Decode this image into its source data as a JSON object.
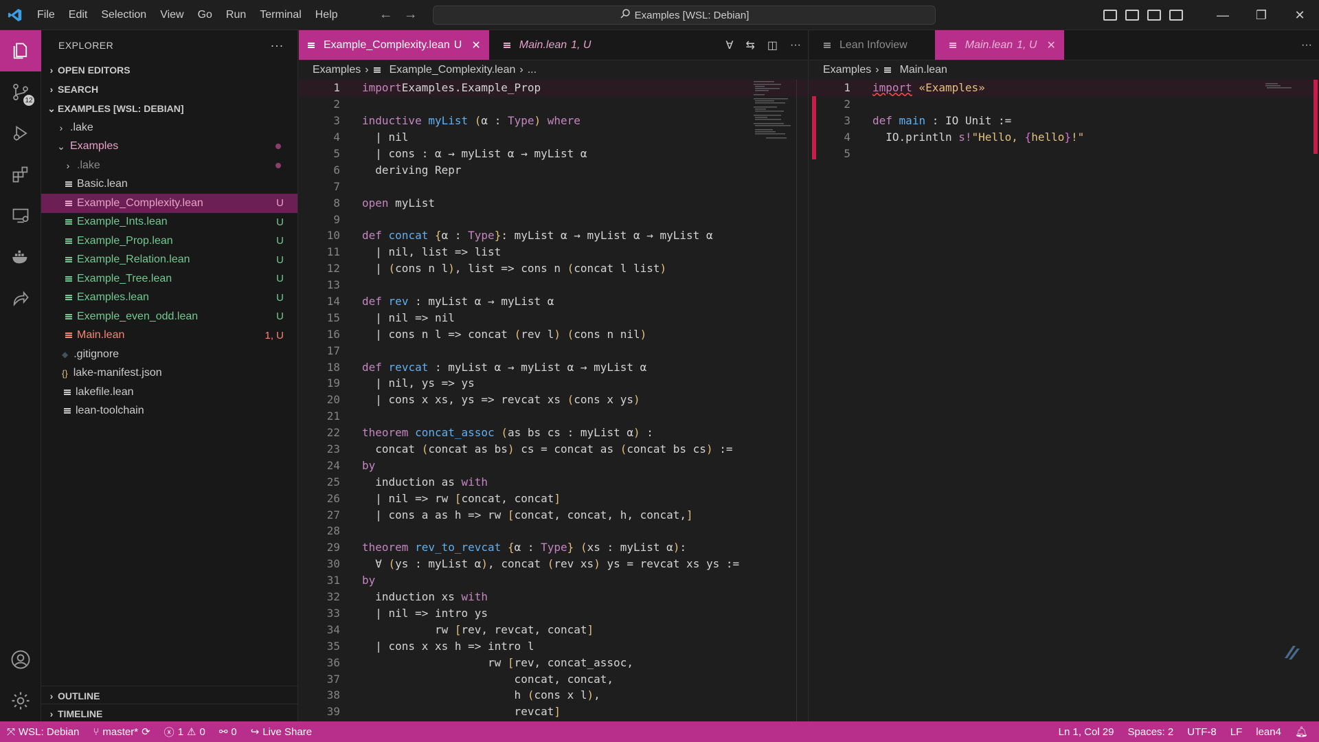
{
  "titlebar": {
    "menu": [
      "File",
      "Edit",
      "Selection",
      "View",
      "Go",
      "Run",
      "Terminal",
      "Help"
    ],
    "search": "Examples [WSL: Debian]"
  },
  "activity": {
    "scm_badge": "12"
  },
  "sidebar": {
    "title": "EXPLORER",
    "open_editors": "OPEN EDITORS",
    "search": "SEARCH",
    "workspace": "EXAMPLES [WSL: DEBIAN]",
    "tree": [
      {
        "name": ".lake",
        "indent": 1,
        "type": "folder",
        "open": false,
        "color": "#cccccc",
        "status": ""
      },
      {
        "name": "Examples",
        "indent": 1,
        "type": "folder",
        "open": true,
        "color": "#e8a2c8",
        "status": "dot"
      },
      {
        "name": ".lake",
        "indent": 2,
        "type": "folder",
        "open": false,
        "color": "#8b8b8b",
        "status": "dot"
      },
      {
        "name": "Basic.lean",
        "indent": 2,
        "type": "file",
        "color": "#cccccc",
        "status": ""
      },
      {
        "name": "Example_Complexity.lean",
        "indent": 2,
        "type": "file",
        "color": "#e8a2c8",
        "status": "U",
        "selected": true
      },
      {
        "name": "Example_Ints.lean",
        "indent": 2,
        "type": "file",
        "color": "#73c991",
        "status": "U"
      },
      {
        "name": "Example_Prop.lean",
        "indent": 2,
        "type": "file",
        "color": "#73c991",
        "status": "U"
      },
      {
        "name": "Example_Relation.lean",
        "indent": 2,
        "type": "file",
        "color": "#73c991",
        "status": "U"
      },
      {
        "name": "Example_Tree.lean",
        "indent": 2,
        "type": "file",
        "color": "#73c991",
        "status": "U"
      },
      {
        "name": "Examples.lean",
        "indent": 2,
        "type": "file",
        "color": "#73c991",
        "status": "U"
      },
      {
        "name": "Exemple_even_odd.lean",
        "indent": 2,
        "type": "file",
        "color": "#73c991",
        "status": "U"
      },
      {
        "name": "Main.lean",
        "indent": 2,
        "type": "file",
        "color": "#f48771",
        "status": "1, U"
      },
      {
        "name": ".gitignore",
        "indent": 1,
        "type": "git",
        "color": "#cccccc",
        "status": ""
      },
      {
        "name": "lake-manifest.json",
        "indent": 1,
        "type": "json",
        "color": "#cccccc",
        "status": ""
      },
      {
        "name": "lakefile.lean",
        "indent": 1,
        "type": "file",
        "color": "#cccccc",
        "status": ""
      },
      {
        "name": "lean-toolchain",
        "indent": 1,
        "type": "file",
        "color": "#cccccc",
        "status": ""
      }
    ],
    "outline": "OUTLINE",
    "timeline": "TIMELINE"
  },
  "editor_left": {
    "tabs": [
      {
        "label": "Example_Complexity.lean",
        "status": "U",
        "active": true
      },
      {
        "label": "Main.lean",
        "status": "1, U",
        "active": false
      }
    ],
    "breadcrumb": [
      "Examples",
      "Example_Complexity.lean",
      "..."
    ],
    "lines": [
      [
        [
          "kw",
          "import"
        ],
        [
          "",
          "Examples.Example_Prop"
        ]
      ],
      [],
      [
        [
          "kw",
          "inductive"
        ],
        [
          "",
          " "
        ],
        [
          "fn",
          "myList"
        ],
        [
          "",
          " "
        ],
        [
          "br",
          "("
        ],
        [
          "",
          "α : "
        ],
        [
          "ty",
          "Type"
        ],
        [
          "br",
          ")"
        ],
        [
          "",
          " "
        ],
        [
          "kw",
          "where"
        ]
      ],
      [
        [
          "",
          "  | nil"
        ]
      ],
      [
        [
          "",
          "  | cons : α → myList α → myList α"
        ]
      ],
      [
        [
          "",
          "  deriving Repr"
        ]
      ],
      [],
      [
        [
          "kw",
          "open"
        ],
        [
          "",
          " myList"
        ]
      ],
      [],
      [
        [
          "kw",
          "def"
        ],
        [
          "",
          " "
        ],
        [
          "fn",
          "concat"
        ],
        [
          "",
          " "
        ],
        [
          "br",
          "{"
        ],
        [
          "",
          "α : "
        ],
        [
          "ty",
          "Type"
        ],
        [
          "br",
          "}"
        ],
        [
          "",
          ": myList α → myList α → myList α"
        ]
      ],
      [
        [
          "",
          "  | nil, list => list"
        ]
      ],
      [
        [
          "",
          "  | "
        ],
        [
          "br",
          "("
        ],
        [
          "",
          "cons n l"
        ],
        [
          "br",
          ")"
        ],
        [
          "",
          ", list => cons n "
        ],
        [
          "br",
          "("
        ],
        [
          "",
          "concat l list"
        ],
        [
          "br",
          ")"
        ]
      ],
      [],
      [
        [
          "kw",
          "def"
        ],
        [
          "",
          " "
        ],
        [
          "fn",
          "rev"
        ],
        [
          "",
          " : myList α → myList α"
        ]
      ],
      [
        [
          "",
          "  | nil => nil"
        ]
      ],
      [
        [
          "",
          "  | cons n l => concat "
        ],
        [
          "br",
          "("
        ],
        [
          "",
          "rev l"
        ],
        [
          "br",
          ")"
        ],
        [
          "",
          " "
        ],
        [
          "br",
          "("
        ],
        [
          "",
          "cons n nil"
        ],
        [
          "br",
          ")"
        ]
      ],
      [],
      [
        [
          "kw",
          "def"
        ],
        [
          "",
          " "
        ],
        [
          "fn",
          "revcat"
        ],
        [
          "",
          " : myList α → myList α → myList α"
        ]
      ],
      [
        [
          "",
          "  | nil, ys => ys"
        ]
      ],
      [
        [
          "",
          "  | cons x xs, ys => revcat xs "
        ],
        [
          "br",
          "("
        ],
        [
          "",
          "cons x ys"
        ],
        [
          "br",
          ")"
        ]
      ],
      [],
      [
        [
          "kw",
          "theorem"
        ],
        [
          "",
          " "
        ],
        [
          "fn",
          "concat_assoc"
        ],
        [
          "",
          " "
        ],
        [
          "br",
          "("
        ],
        [
          "",
          "as bs cs : myList α"
        ],
        [
          "br",
          ")"
        ],
        [
          "",
          " :"
        ]
      ],
      [
        [
          "",
          "  concat "
        ],
        [
          "br",
          "("
        ],
        [
          "",
          "concat as bs"
        ],
        [
          "br",
          ")"
        ],
        [
          "",
          " cs = concat as "
        ],
        [
          "br",
          "("
        ],
        [
          "",
          "concat bs cs"
        ],
        [
          "br",
          ")"
        ],
        [
          "",
          " :="
        ]
      ],
      [
        [
          "kw",
          "by"
        ]
      ],
      [
        [
          "",
          "  induction as "
        ],
        [
          "kw",
          "with"
        ]
      ],
      [
        [
          "",
          "  | nil => rw "
        ],
        [
          "br",
          "["
        ],
        [
          "",
          "concat, concat"
        ],
        [
          "br",
          "]"
        ]
      ],
      [
        [
          "",
          "  | cons a as h => rw "
        ],
        [
          "br",
          "["
        ],
        [
          "",
          "concat, concat, h, concat,"
        ],
        [
          "br",
          "]"
        ]
      ],
      [],
      [
        [
          "kw",
          "theorem"
        ],
        [
          "",
          " "
        ],
        [
          "fn",
          "rev_to_revcat"
        ],
        [
          "",
          " "
        ],
        [
          "br",
          "{"
        ],
        [
          "",
          "α : "
        ],
        [
          "ty",
          "Type"
        ],
        [
          "br",
          "}"
        ],
        [
          "",
          " "
        ],
        [
          "br",
          "("
        ],
        [
          "",
          "xs : myList α"
        ],
        [
          "br",
          ")"
        ],
        [
          "",
          ":"
        ]
      ],
      [
        [
          "",
          "  ∀ "
        ],
        [
          "br",
          "("
        ],
        [
          "",
          "ys : myList α"
        ],
        [
          "br",
          ")"
        ],
        [
          "",
          ", concat "
        ],
        [
          "br",
          "("
        ],
        [
          "",
          "rev xs"
        ],
        [
          "br",
          ")"
        ],
        [
          "",
          " ys = revcat xs ys :="
        ]
      ],
      [
        [
          "kw",
          "by"
        ]
      ],
      [
        [
          "",
          "  induction xs "
        ],
        [
          "kw",
          "with"
        ]
      ],
      [
        [
          "",
          "  | nil => intro ys"
        ]
      ],
      [
        [
          "",
          "           rw "
        ],
        [
          "br",
          "["
        ],
        [
          "",
          "rev, revcat, concat"
        ],
        [
          "br",
          "]"
        ]
      ],
      [
        [
          "",
          "  | cons x xs h => intro l"
        ]
      ],
      [
        [
          "",
          "                   rw "
        ],
        [
          "br",
          "["
        ],
        [
          "",
          "rev, concat_assoc,"
        ]
      ],
      [
        [
          "",
          "                       concat, concat,"
        ]
      ],
      [
        [
          "",
          "                       h "
        ],
        [
          "br",
          "("
        ],
        [
          "",
          "cons x l"
        ],
        [
          "br",
          ")"
        ],
        [
          "",
          ","
        ]
      ],
      [
        [
          "",
          "                       revcat"
        ],
        [
          "br",
          "]"
        ]
      ]
    ]
  },
  "editor_right": {
    "tabs": [
      {
        "label": "Lean Infoview",
        "active": false
      },
      {
        "label": "Main.lean",
        "status": "1, U",
        "active": true
      }
    ],
    "breadcrumb": [
      "Examples",
      "Main.lean"
    ],
    "lines": [
      [
        [
          "kw",
          "import"
        ],
        [
          "",
          " "
        ],
        [
          "str",
          "«Examples»"
        ]
      ],
      [],
      [
        [
          "kw",
          "def"
        ],
        [
          "",
          " "
        ],
        [
          "fn",
          "main"
        ],
        [
          "",
          " : IO Unit :="
        ]
      ],
      [
        [
          "",
          "  IO.println "
        ],
        [
          "kw",
          "s!"
        ],
        [
          "str",
          "\"Hello, "
        ],
        [
          "br2",
          "{"
        ],
        [
          "str",
          "hello"
        ],
        [
          "br2",
          "}"
        ],
        [
          "str",
          "!\""
        ]
      ],
      []
    ]
  },
  "status": {
    "remote": "WSL: Debian",
    "branch": "master*",
    "errors": "1",
    "warnings": "0",
    "ports": "0",
    "liveshare": "Live Share",
    "position": "Ln 1, Col 29",
    "spaces": "Spaces: 2",
    "encoding": "UTF-8",
    "eol": "LF",
    "language": "lean4"
  },
  "colors": {
    "accent": "#b72f8b",
    "untracked": "#73c991",
    "modified": "#e8a2c8",
    "error": "#f48771"
  }
}
